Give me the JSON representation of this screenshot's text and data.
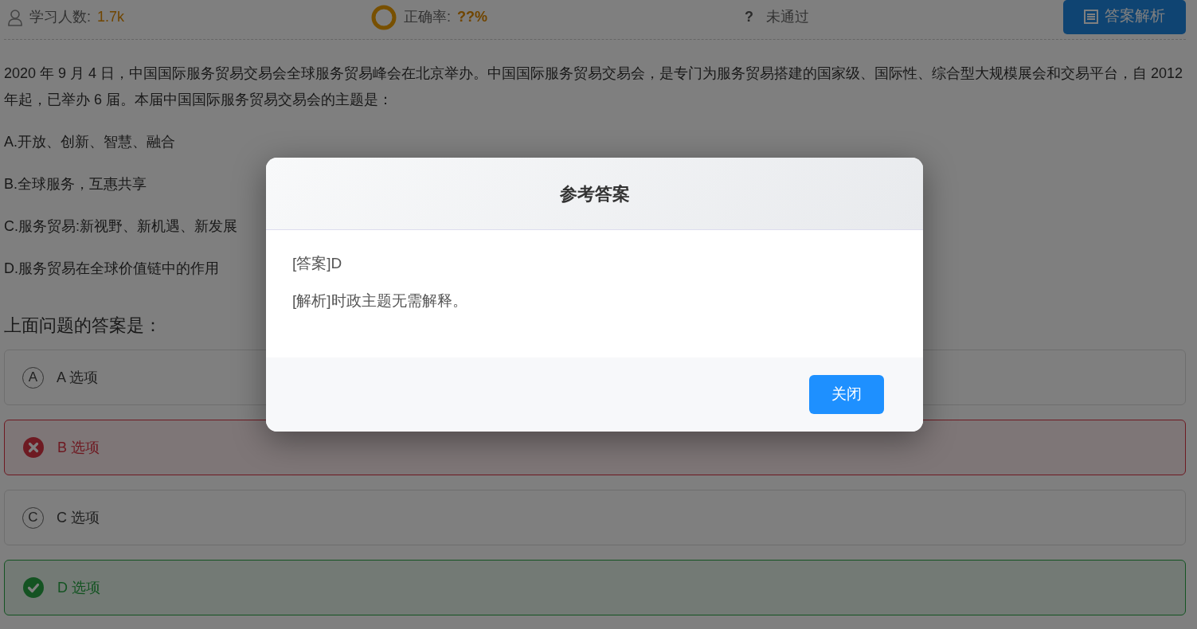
{
  "stats": {
    "learners_label": "学习人数:",
    "learners": "1.7k",
    "accuracy_label": "正确率:",
    "accuracy": "??%",
    "status_mark": "?",
    "status": "未通过",
    "analysis_button": "答案解析"
  },
  "question": {
    "text": "2020 年 9 月 4 日，中国国际服务贸易交易会全球服务贸易峰会在北京举办。中国国际服务贸易交易会，是专门为服务贸易搭建的国家级、国际性、综合型大规模展会和交易平台，自 2012 年起，已举办 6 届。本届中国国际服务贸易交易会的主题是：",
    "choices": [
      "A.开放、创新、智慧、融合",
      "B.全球服务，互惠共享",
      "C.服务贸易:新视野、新机遇、新发展",
      "D.服务贸易在全球价值链中的作用"
    ]
  },
  "prompt": "上面问题的答案是：",
  "options": [
    {
      "letter": "A",
      "label": "A 选项",
      "kind": "plain"
    },
    {
      "label": "B 选项",
      "kind": "wrong"
    },
    {
      "letter": "C",
      "label": "C 选项",
      "kind": "plain"
    },
    {
      "label": "D 选项",
      "kind": "correct"
    }
  ],
  "modal": {
    "title": "参考答案",
    "lines": [
      "[答案]D",
      "[解析]时政主题无需解释。"
    ],
    "close_button": "关闭"
  }
}
